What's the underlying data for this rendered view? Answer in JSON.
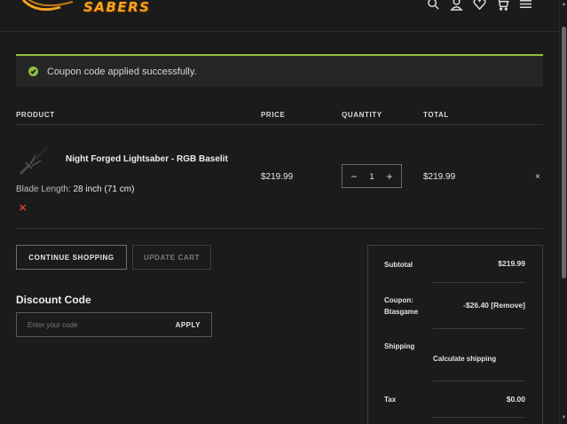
{
  "header": {
    "logo_text": "SABERS",
    "icons": [
      "search-icon",
      "user-icon",
      "heart-icon",
      "cart-icon",
      "menu-icon"
    ]
  },
  "notice": {
    "message": "Coupon code applied successfully.",
    "color": "#8fbf3f"
  },
  "table": {
    "columns": [
      "PRODUCT",
      "PRICE",
      "QUANTITY",
      "TOTAL"
    ],
    "item": {
      "name": "Night Forged Lightsaber - RGB Baselit",
      "option_label": "Blade Length:",
      "option_value": "28 inch (71 cm)",
      "remove_option": "✕",
      "price": "$219.99",
      "quantity": "1",
      "minus": "−",
      "plus": "+",
      "total": "$219.99",
      "remove": "×"
    }
  },
  "actions": {
    "continue": "CONTINUE SHOPPING",
    "update": "UPDATE CART"
  },
  "discount": {
    "title": "Discount Code",
    "placeholder": "Enter your code",
    "apply": "APPLY"
  },
  "totals": {
    "subtotal_label": "Subtotal",
    "subtotal_value": "$219.99",
    "coupon_label": "Coupon:",
    "coupon_code": "Btasgame",
    "coupon_value": "-$26.40 [Remove]",
    "shipping_label": "Shipping",
    "shipping_value": "Calculate shipping",
    "tax_label": "Tax",
    "tax_value": "$0.00"
  },
  "colors": {
    "background": "#1b1b1b",
    "accent": "#f2a31c",
    "success": "#8fbf3f",
    "danger": "#e03a3a"
  }
}
